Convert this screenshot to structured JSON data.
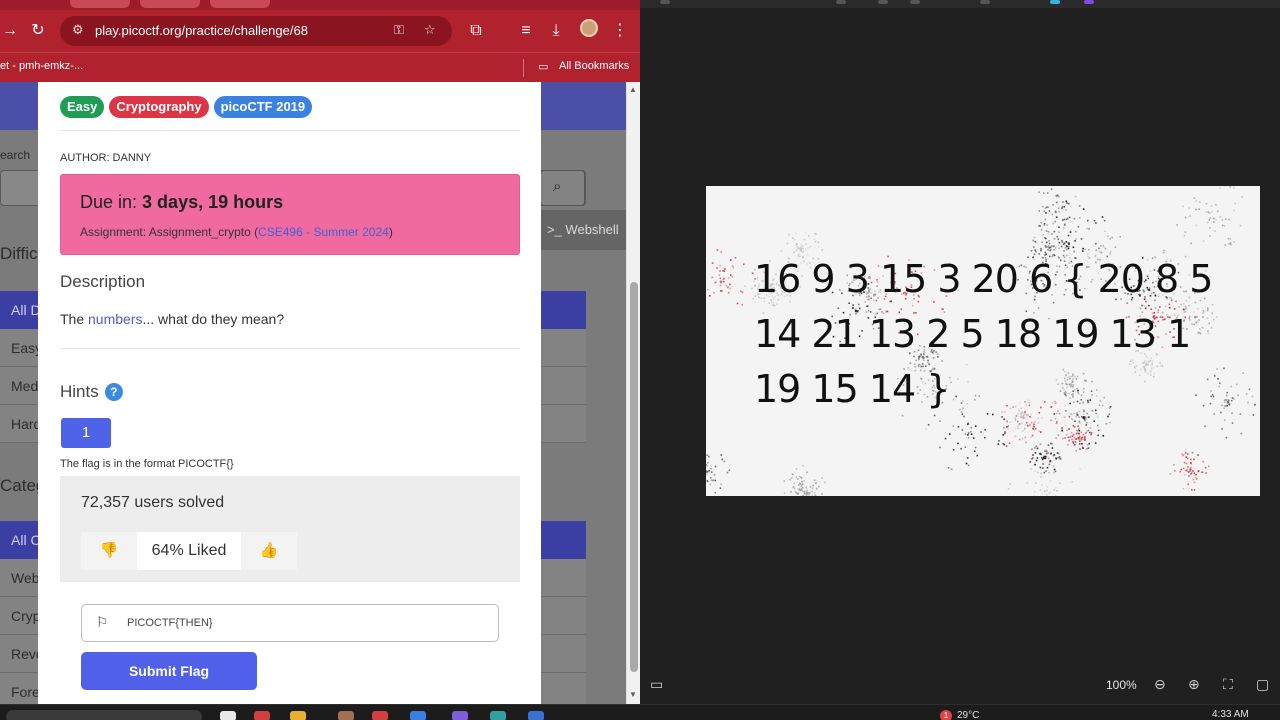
{
  "browser": {
    "url": "play.picoctf.org/practice/challenge/68",
    "bookmark_left": "et - pmh-emkz-...",
    "all_bookmarks": "All Bookmarks"
  },
  "background_page": {
    "search_label": "earch",
    "difficulty_heading": "Difficu",
    "difficulty_items": [
      "All D",
      "Easy",
      "Med",
      "Hard"
    ],
    "category_heading": "Categ",
    "category_items": [
      "All C",
      "Web",
      "Cryp",
      "Reve",
      "Fore"
    ],
    "webshell": ">_ Webshell"
  },
  "challenge": {
    "tags": [
      {
        "label": "Easy",
        "color": "#1f9d55"
      },
      {
        "label": "Cryptography",
        "color": "#dc3545"
      },
      {
        "label": "picoCTF 2019",
        "color": "#3b82e0"
      }
    ],
    "author": "AUTHOR: DANNY",
    "due_prefix": "Due in: ",
    "due_value": "3 days, 19 hours",
    "assignment_prefix": "Assignment: Assignment_crypto (",
    "assignment_link": "CSE496 - Summer 2024",
    "assignment_suffix": ")",
    "description_heading": "Description",
    "description_prefix": "The ",
    "description_link": "numbers",
    "description_suffix": "... what do they mean?",
    "hints_heading": "Hints",
    "hint_button": "1",
    "hint_text": "The flag is in the format PICOCTF{}",
    "users_solved": "72,357 users solved",
    "liked": "64% Liked",
    "flag_value": "PICOCTF{THEN}",
    "submit_label": "Submit Flag"
  },
  "viewer": {
    "cipher_lines": [
      "16 9 3 15 3 20 6 { 20 8 5",
      "14 21 13 2 5 18 19 13 1",
      "19 15 14 }"
    ],
    "zoom": "100%"
  },
  "taskbar": {
    "notification_count": "1",
    "temperature": "29°C",
    "time": "4:33 AM"
  }
}
